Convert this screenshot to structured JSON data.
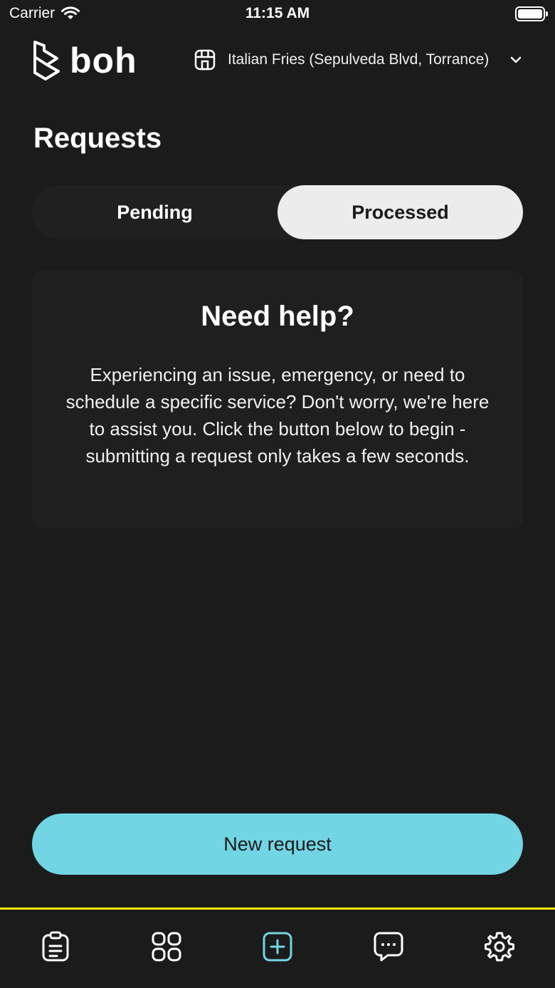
{
  "status_bar": {
    "carrier": "Carrier",
    "time": "11:15 AM"
  },
  "header": {
    "logo_text": "boh",
    "location_name": "Italian Fries (Sepulveda Blvd, Torrance)"
  },
  "page": {
    "title": "Requests"
  },
  "tabs": [
    {
      "label": "Pending",
      "selected": false
    },
    {
      "label": "Processed",
      "selected": true
    }
  ],
  "help_card": {
    "title": "Need help?",
    "body": "Experiencing an issue, emergency, or need to schedule a specific service? Don't worry, we're here to assist you. Click the button below to begin - submitting a request only takes a few seconds."
  },
  "actions": {
    "new_request_label": "New request"
  },
  "colors": {
    "background": "#1b1b1c",
    "accent": "#72d5e3",
    "tab_bar_border": "#ffeb00",
    "active_tab_icon": "#72d5e3"
  },
  "bottom_nav": [
    {
      "icon": "clipboard-icon",
      "active": false
    },
    {
      "icon": "grid-icon",
      "active": false
    },
    {
      "icon": "add-square-icon",
      "active": true
    },
    {
      "icon": "chat-icon",
      "active": false
    },
    {
      "icon": "gear-icon",
      "active": false
    }
  ]
}
